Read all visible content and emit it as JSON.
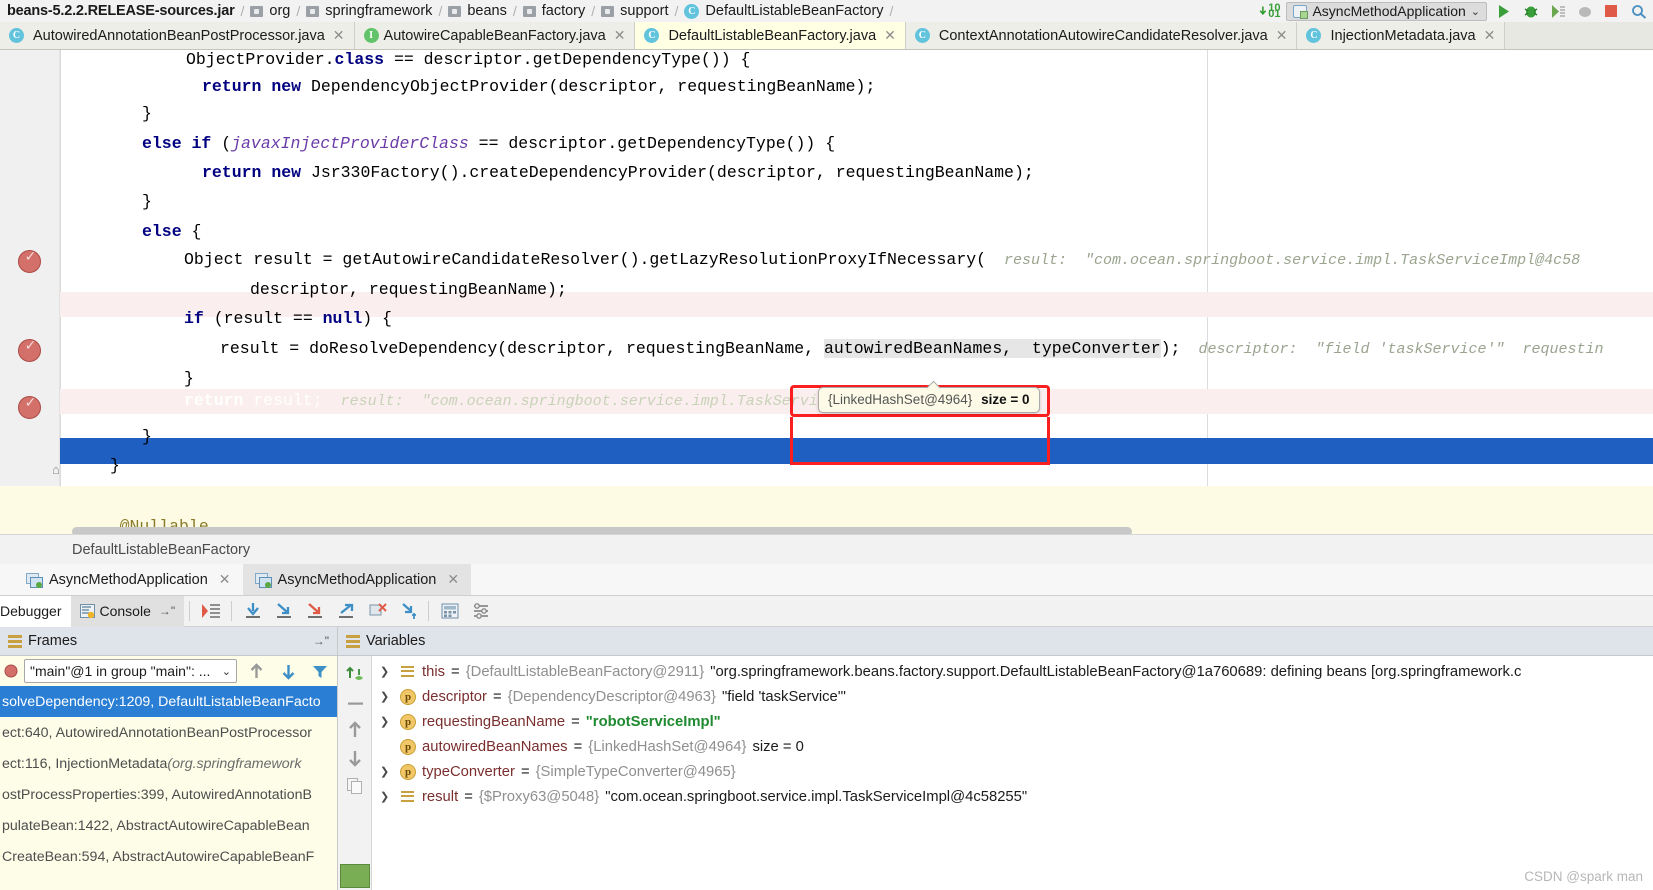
{
  "navbar": {
    "breadcrumbs": [
      {
        "label": "beans-5.2.2.RELEASE-sources.jar",
        "icon": "jar-icon"
      },
      {
        "label": "org",
        "icon": "package-icon"
      },
      {
        "label": "springframework",
        "icon": "package-icon"
      },
      {
        "label": "beans",
        "icon": "package-icon"
      },
      {
        "label": "factory",
        "icon": "package-icon"
      },
      {
        "label": "support",
        "icon": "package-icon"
      },
      {
        "label": "DefaultListableBeanFactory",
        "icon": "class-icon"
      }
    ],
    "download_badge": "10\n01",
    "run_config": {
      "label": "AsyncMethodApplication",
      "icon": "app-config-icon",
      "chevron": "⌄"
    },
    "toolbar_icons": [
      "run-icon",
      "debug-icon",
      "coverage-icon",
      "profile-icon",
      "stop-icon",
      "search-icon"
    ]
  },
  "editor_tabs": [
    {
      "label": "AutowiredAnnotationBeanPostProcessor.java",
      "icon": "class-icon",
      "active": false,
      "close": "✕"
    },
    {
      "label": "AutowireCapableBeanFactory.java",
      "icon": "interface-icon",
      "active": false,
      "close": "✕"
    },
    {
      "label": "DefaultListableBeanFactory.java",
      "icon": "class-icon",
      "active": true,
      "close": "✕"
    },
    {
      "label": "ContextAnnotationAutowireCandidateResolver.java",
      "icon": "class-icon",
      "active": false,
      "close": "✕"
    },
    {
      "label": "InjectionMetadata.java",
      "icon": "class-icon",
      "active": false,
      "close": "✕"
    }
  ],
  "code": {
    "lines": [
      {
        "indent": 8,
        "segments": [
          {
            "t": "ObjectProvider.",
            "c": "plain"
          },
          {
            "t": "class",
            "c": "kw"
          },
          {
            "t": " == descriptor.getDependencyType()) {",
            "c": "plain"
          }
        ]
      },
      {
        "indent": 10,
        "segments": [
          {
            "t": "return",
            "c": "kw"
          },
          {
            "t": " ",
            "c": "plain"
          },
          {
            "t": "new",
            "c": "kw"
          },
          {
            "t": " DependencyObjectProvider(descriptor, requestingBeanName);",
            "c": "plain"
          }
        ]
      },
      {
        "indent": 8,
        "segments": [
          {
            "t": "}",
            "c": "plain"
          }
        ]
      },
      {
        "indent": 8,
        "segments": [
          {
            "t": "else",
            "c": "kw"
          },
          {
            "t": " ",
            "c": "plain"
          },
          {
            "t": "if",
            "c": "kw"
          },
          {
            "t": " (",
            "c": "plain"
          },
          {
            "t": "javaxInjectProviderClass",
            "c": "field"
          },
          {
            "t": " == descriptor.getDependencyType()) {",
            "c": "plain"
          }
        ]
      },
      {
        "indent": 10,
        "segments": [
          {
            "t": "return",
            "c": "kw"
          },
          {
            "t": " ",
            "c": "plain"
          },
          {
            "t": "new",
            "c": "kw"
          },
          {
            "t": " Jsr330Factory().createDependencyProvider(descriptor, requestingBeanName);",
            "c": "plain"
          }
        ]
      },
      {
        "indent": 8,
        "segments": [
          {
            "t": "}",
            "c": "plain"
          }
        ]
      },
      {
        "indent": 8,
        "segments": [
          {
            "t": "else",
            "c": "kw"
          },
          {
            "t": " {",
            "c": "plain"
          }
        ]
      },
      {
        "indent": 10,
        "segments": [
          {
            "t": "Object result = getAutowireCandidateResolver().getLazyResolutionProxyIfNecessary(",
            "c": "plain"
          },
          {
            "t": "  result:  \"com.ocean.springboot.service.impl.TaskServiceImpl@4c58",
            "c": "hint"
          }
        ]
      },
      {
        "indent": 14,
        "segments": [
          {
            "t": "descriptor, requestingBeanName);",
            "c": "plain"
          }
        ]
      },
      {
        "indent": 10,
        "segments": [
          {
            "t": "if",
            "c": "kw"
          },
          {
            "t": " (result == ",
            "c": "plain"
          },
          {
            "t": "null",
            "c": "kw"
          },
          {
            "t": ") {",
            "c": "plain"
          }
        ]
      },
      {
        "indent": 12,
        "segments": [
          {
            "t": "result = doResolveDependency(descriptor, requestingBeanName, ",
            "c": "plain"
          },
          {
            "t": "autowiredBeanNames",
            "c": "boxed"
          },
          {
            "t": ", typeConverter);",
            "c": "plain"
          },
          {
            "t": "  descriptor:  \"field 'taskService'\"  requestin",
            "c": "hint"
          }
        ]
      },
      {
        "indent": 10,
        "segments": [
          {
            "t": "}",
            "c": "plain"
          }
        ]
      },
      {
        "indent": 10,
        "segments": [
          {
            "t": "return",
            "c": "kw"
          },
          {
            "t": " result;",
            "c": "plain"
          },
          {
            "t": "  result:  \"com.ocean.springboot.service.impl.TaskServiceImpl@4c58255\"",
            "c": "hint"
          }
        ]
      },
      {
        "indent": 8,
        "segments": [
          {
            "t": "}",
            "c": "plain"
          }
        ]
      },
      {
        "indent": 6,
        "segments": [
          {
            "t": "}",
            "c": "plain"
          }
        ]
      },
      {
        "indent": 0,
        "segments": []
      },
      {
        "indent": 6,
        "segments": [
          {
            "t": "@Nullable",
            "c": "anno"
          }
        ]
      }
    ],
    "breakpoint_lines": [
      7,
      10,
      12
    ],
    "current_line": 12,
    "highlighted_lines": [
      7,
      10
    ],
    "annotation_box_text": "autowiredBeanNames,  typeConverter"
  },
  "tooltip": {
    "object_ref": "{LinkedHashSet@4964}",
    "size_text": "size = 0"
  },
  "editor_breadcrumb": {
    "label": "DefaultListableBeanFactory"
  },
  "session_tabs": [
    {
      "label": "AsyncMethodApplication",
      "active": false,
      "icon": "run-app-icon",
      "close": "✕"
    },
    {
      "label": "AsyncMethodApplication",
      "active": true,
      "icon": "run-app-icon",
      "close": "✕"
    }
  ],
  "debug_toolbar": {
    "debugger_tab": "Debugger",
    "console_tab": "Console",
    "pin": "→\"",
    "buttons": [
      "show-execution-point-icon",
      "step-over-icon",
      "step-into-icon",
      "force-step-into-icon",
      "step-out-icon",
      "drop-frame-icon",
      "run-to-cursor-icon",
      "evaluate-expression-icon",
      "settings-icon"
    ]
  },
  "frames_pane": {
    "title": "Frames",
    "pin": "→\"",
    "thread": "\"main\"@1 in group \"main\": ...",
    "thread_chevron": "⌄",
    "nav_icons": [
      "arrow-up-icon",
      "arrow-down-icon",
      "filter-icon"
    ],
    "stack": [
      {
        "text": "solveDependency:1209, DefaultListableBeanFacto",
        "pkg": "",
        "selected": true
      },
      {
        "text": "ect:640, AutowiredAnnotationBeanPostProcessor",
        "pkg": "",
        "selected": false
      },
      {
        "text": "ect:116, InjectionMetadata ",
        "pkg": "(org.springframework",
        "selected": false
      },
      {
        "text": "ostProcessProperties:399, AutowiredAnnotationB",
        "pkg": "",
        "selected": false
      },
      {
        "text": "pulateBean:1422, AbstractAutowireCapableBean",
        "pkg": "",
        "selected": false
      },
      {
        "text": "CreateBean:594, AbstractAutowireCapableBeanF",
        "pkg": "",
        "selected": false
      }
    ]
  },
  "variables_pane": {
    "title": "Variables",
    "side_icons": [
      "add-watch-icon",
      "remove-icon",
      "move-up-icon",
      "move-down-icon",
      "copy-icon"
    ],
    "rows": [
      {
        "expandable": true,
        "icon": "field-icon",
        "name": "this",
        "ref": "{DefaultListableBeanFactory@2911}",
        "value": "\"org.springframework.beans.factory.support.DefaultListableBeanFactory@1a760689: defining beans [org.springframework.c",
        "value_style": "plain"
      },
      {
        "expandable": true,
        "icon": "param-icon",
        "name": "descriptor",
        "ref": "{DependencyDescriptor@4963}",
        "value": "\"field 'taskService'\"",
        "value_style": "plain"
      },
      {
        "expandable": true,
        "icon": "param-icon",
        "name": "requestingBeanName",
        "ref": "",
        "value": "\"robotServiceImpl\"",
        "value_style": "green"
      },
      {
        "expandable": false,
        "icon": "param-icon",
        "name": "autowiredBeanNames",
        "ref": "{LinkedHashSet@4964}",
        "value": "size = 0",
        "value_style": "plain"
      },
      {
        "expandable": true,
        "icon": "param-icon",
        "name": "typeConverter",
        "ref": "{SimpleTypeConverter@4965}",
        "value": "",
        "value_style": "plain"
      },
      {
        "expandable": true,
        "icon": "field-icon",
        "name": "result",
        "ref": "{$Proxy63@5048}",
        "value": "\"com.ocean.springboot.service.impl.TaskServiceImpl@4c58255\"",
        "value_style": "plain"
      }
    ]
  },
  "watermark": "CSDN @spark man",
  "colors": {
    "accent_blue": "#2a7fd4",
    "current_line": "#1f5fc2",
    "breakpoint_bg": "#fbeeee",
    "annotation_red": "#fc1f1f",
    "tooltip_bg": "#fdfbe8",
    "active_tab": "#ffffe4"
  }
}
